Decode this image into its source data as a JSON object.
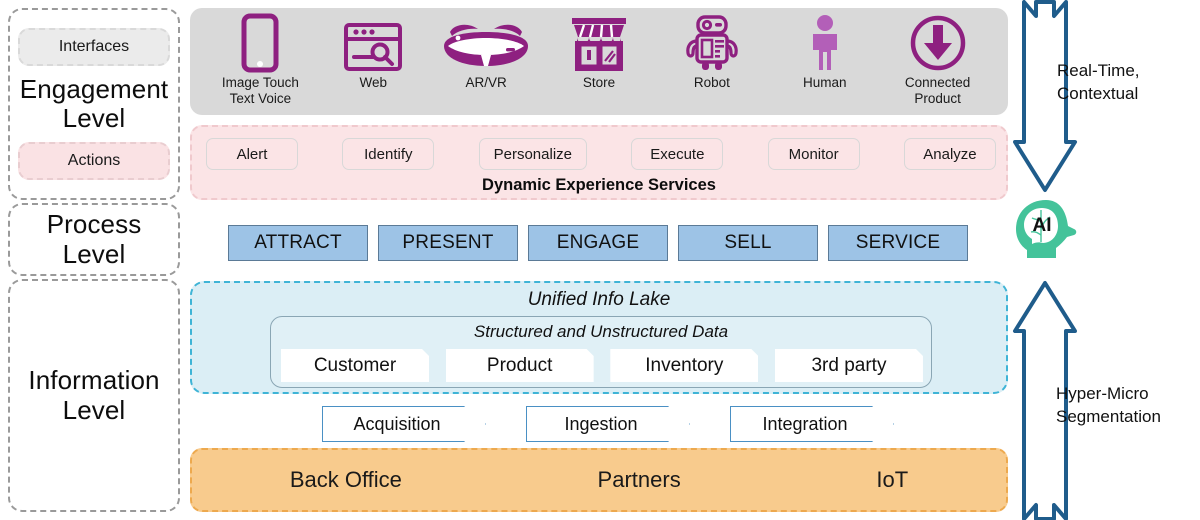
{
  "levels": [
    {
      "name": "engagement",
      "title": "Engagement\nLevel",
      "title_line1": "Engagement",
      "title_line2": "Level",
      "chips": [
        {
          "label": "Interfaces",
          "color": "#ebebeb"
        },
        {
          "label": "Actions",
          "color": "#fae2e4"
        }
      ]
    },
    {
      "name": "process",
      "title_line1": "Process",
      "title_line2": "Level"
    },
    {
      "name": "information",
      "title_line1": "Information",
      "title_line2": "Level"
    }
  ],
  "engagement": {
    "panel_color": "#d9d9d9",
    "interfaces": [
      {
        "icon": "smartphone-icon",
        "label_line1": "Image Touch",
        "label_line2": "Text Voice"
      },
      {
        "icon": "web-browser-search-icon",
        "label_line1": "Web",
        "label_line2": ""
      },
      {
        "icon": "ar-vr-headset-icon",
        "label_line1": "AR/VR",
        "label_line2": ""
      },
      {
        "icon": "storefront-icon",
        "label_line1": "Store",
        "label_line2": ""
      },
      {
        "icon": "robot-icon",
        "label_line1": "Robot",
        "label_line2": ""
      },
      {
        "icon": "human-person-icon",
        "label_line1": "Human",
        "label_line2": ""
      },
      {
        "icon": "connected-product-download-icon",
        "label_line1": "Connected",
        "label_line2": "Product"
      }
    ]
  },
  "actions": {
    "panel_color": "#fbe4e6",
    "chips": [
      "Alert",
      "Identify",
      "Personalize",
      "Execute",
      "Monitor",
      "Analyze"
    ],
    "caption": "Dynamic Experience Services"
  },
  "process": {
    "box_color": "#9dc3e6",
    "stages": [
      "ATTRACT",
      "PRESENT",
      "ENGAGE",
      "SELL",
      "SERVICE"
    ]
  },
  "information": {
    "lake_title": "Unified Info Lake",
    "lake_color": "#dbeef5",
    "lake_border": "#3fb4d6",
    "inner_title": "Structured and Unstructured Data",
    "data_cards": [
      "Customer",
      "Product",
      "Inventory",
      "3rd party"
    ],
    "pipeline": [
      "Acquisition",
      "Ingestion",
      "Integration"
    ],
    "sources_color": "#f8cb8d",
    "sources": [
      "Back Office",
      "Partners",
      "IoT"
    ]
  },
  "right_column": {
    "down_arrow": {
      "name": "real-time-contextual-arrow",
      "label_line1": "Real-Time,",
      "label_line2": "Contextual",
      "color": "#1f5c8b"
    },
    "ai_badge": {
      "name": "ai-brain-badge",
      "label": "AI",
      "color": "#44c39a"
    },
    "up_arrow": {
      "name": "hyper-micro-segmentation-arrow",
      "label_line1": "Hyper-Micro",
      "label_line2": "Segmentation",
      "color": "#1f5c8b"
    }
  },
  "palette": {
    "icon_purple": "#8e2080",
    "icon_orchid": "#b35fb8",
    "dashed_gray": "#9a9a9a",
    "process_border": "#5b7a96"
  }
}
